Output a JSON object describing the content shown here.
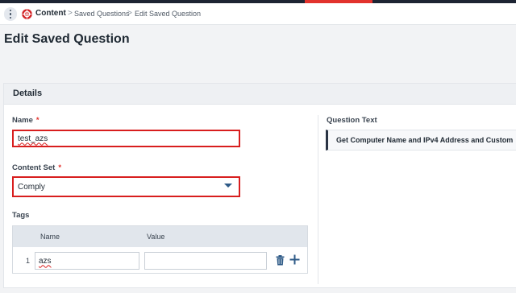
{
  "breadcrumb": {
    "app": "Content",
    "link": "Saved Questions",
    "current": "Edit Saved Question",
    "separator": ">"
  },
  "page_title": "Edit Saved Question",
  "card": {
    "header": "Details"
  },
  "form": {
    "name_label": "Name",
    "name_value": "test_azs",
    "content_set_label": "Content Set",
    "content_set_value": "Comply",
    "required_marker": "*",
    "tags_label": "Tags"
  },
  "tags_table": {
    "columns": [
      "Name",
      "Value"
    ],
    "rows": [
      {
        "index": "1",
        "name": "azs",
        "value": ""
      }
    ]
  },
  "question": {
    "label": "Question Text",
    "text": "Get Computer Name and IPv4 Address and Custom"
  },
  "colors": {
    "accent_red": "#e2322d",
    "error_border": "#d81e1e",
    "dark_nav": "#1d2433",
    "link_blue": "#2e5a87"
  },
  "icons": {
    "menu": "more-vertical-icon",
    "app": "content-logo-icon",
    "select": "caret-down-icon",
    "delete": "trash-icon",
    "add": "plus-icon"
  }
}
